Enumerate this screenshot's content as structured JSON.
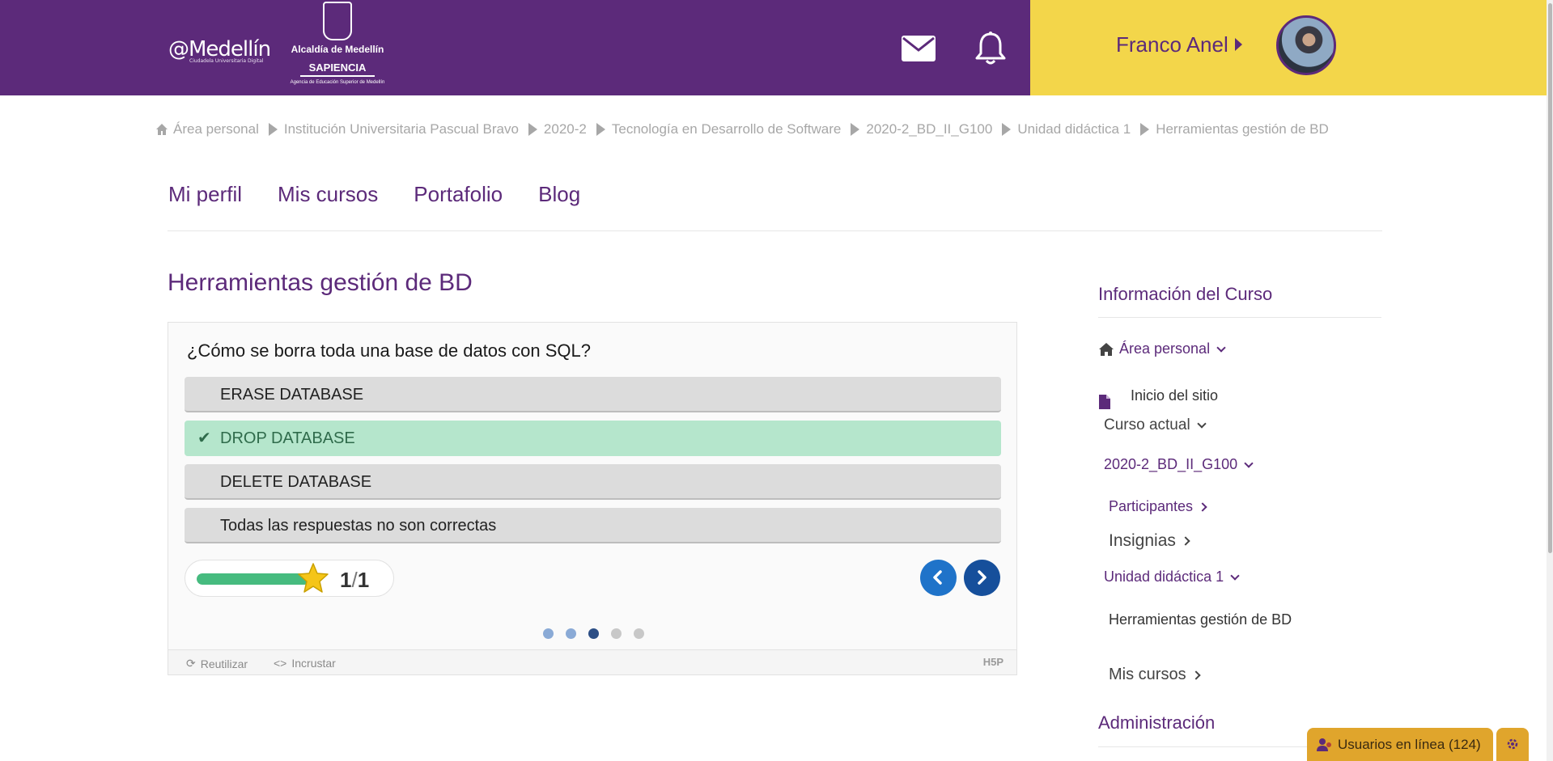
{
  "header": {
    "logo_medellin": "@Medellín",
    "logo_medellin_sub": "Ciudadela Universitaria Digital",
    "logo_alcaldia": "Alcaldía de Medellín",
    "logo_sapiencia": "SAPIENCIA",
    "logo_sapiencia_sub": "Agencia de Educación Superior de Medellín",
    "user_name": "Franco Anel",
    "colors": {
      "primary": "#5c2a7a",
      "accent": "#f3d64a"
    }
  },
  "breadcrumb": [
    "Área personal",
    "Institución Universitaria Pascual Bravo",
    "2020-2",
    "Tecnología en Desarrollo de Software",
    "2020-2_BD_II_G100",
    "Unidad didáctica 1",
    "Herramientas gestión de BD"
  ],
  "tabs": [
    "Mi perfil",
    "Mis cursos",
    "Portafolio",
    "Blog"
  ],
  "page_title": "Herramientas gestión de BD",
  "quiz": {
    "question": "¿Cómo se borra toda una base de datos con SQL?",
    "answers": [
      {
        "text": "ERASE DATABASE",
        "correct": false
      },
      {
        "text": "DROP DATABASE",
        "correct": true
      },
      {
        "text": "DELETE DATABASE",
        "correct": false
      },
      {
        "text": "Todas las respuestas no son correctas",
        "correct": false
      }
    ],
    "score": "1",
    "max_score": "1",
    "progress": 1.0,
    "slides_total": 5,
    "slide_current": 3,
    "footer_reuse": "Reutilizar",
    "footer_embed": "Incrustar",
    "h5p_logo": "H5P",
    "colors": {
      "correct_bg": "#b5e6cc",
      "progress": "#46bb7f",
      "star": "#f5c518"
    }
  },
  "sidebar": {
    "title": "Información del Curso",
    "home": "Área personal",
    "site_home": "Inicio del sitio",
    "current_course": "Curso actual",
    "course_code": "2020-2_BD_II_G100",
    "participants": "Participantes",
    "badges": "Insignias",
    "unit": "Unidad didáctica 1",
    "activity": "Herramientas gestión de BD",
    "my_courses": "Mis cursos",
    "admin_title": "Administración"
  },
  "online_users": "Usuarios en línea (124)"
}
